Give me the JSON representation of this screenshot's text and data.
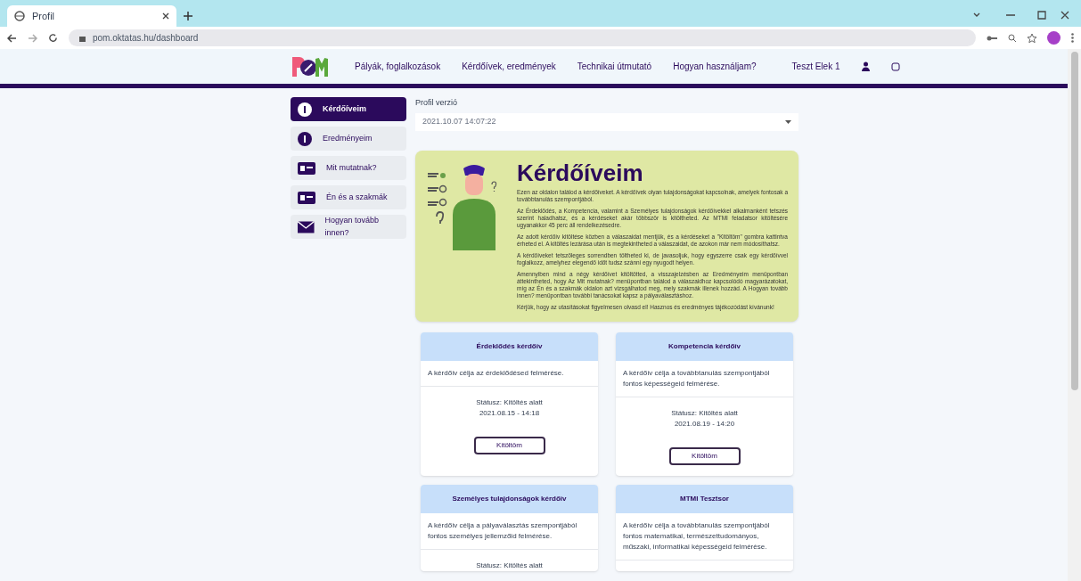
{
  "browser": {
    "tab_title": "Profil",
    "url": "pom.oktatas.hu/dashboard"
  },
  "header": {
    "nav": [
      {
        "label": "Pályák, foglalkozások"
      },
      {
        "label": "Kérdőívek, eredmények"
      },
      {
        "label": "Technikai útmutató"
      },
      {
        "label": "Hogyan használjam?"
      }
    ],
    "user": "Teszt Elek 1"
  },
  "sidebar": {
    "items": [
      {
        "label": "Kérdőíveim",
        "selected": true
      },
      {
        "label": "Eredményeim",
        "selected": false
      },
      {
        "label": "Mit mutatnak?",
        "selected": false
      },
      {
        "label": "Én és a szakmák",
        "selected": false
      },
      {
        "label": "Hogyan tovább innen?",
        "selected": false
      }
    ]
  },
  "profile": {
    "label": "Profil verzió",
    "value": "2021.10.07 14:07:22"
  },
  "hero": {
    "title": "Kérdőíveim",
    "paragraphs": [
      "Ezen az oldalon találod a kérdőíveket. A kérdőívek olyan tulajdonságokat kapcsolnak, amelyek fontosak a továbbtanulás szempontjából.",
      "Az Érdeklődés, a Kompetencia, valamint a Személyes tulajdonságok kérdőívekkel alkalmanként tetszés szerint haladhatsz, és a kérdéseket akár többször is kitöltheted. Az MTMI feladatsor kitöltésére ugyanakkor 45 perc áll rendelkezésedre.",
      "Az adott kérdőív kitöltése közben a válaszaidat mentjük, és a kérdéseket a \"Kitöltöm\" gombra kattintva érheted el. A kitöltés lezárása után is megtekintheted a válaszaidat, de azokon már nem módosíthatsz.",
      "A kérdőíveket tetszőleges sorrendben töltheted ki, de javasoljuk, hogy egyszerre csak egy kérdőívvel foglalkozz, amelyhez elegendő időt tudsz szánni egy nyugodt helyen.",
      "Amennyiben mind a négy kérdőívet kitöltötted, a visszajelzésben az Eredményeim menüpontban áttekintheted, hogy Az Mit mutatnak? menüpontban találod a válaszaidhoz kapcsolódó magyarázatokat, míg az Én és a szakmák oldalon azt vizsgálhatod meg, mely szakmák illenek hozzád. A Hogyan tovább innen? menüpontban további tanácsokat kapsz a pályaválasztáshoz.",
      "Kérjük, hogy az utasításokat figyelmesen olvasd el! Hasznos és eredményes tájékozódást kívánunk!"
    ]
  },
  "cards": [
    {
      "title": "Érdeklődés kérdőív",
      "description": "A kérdőív célja az érdeklődésed felmérése.",
      "status": "Státusz: Kitöltés alatt",
      "date": "2021.08.15 - 14:18",
      "button": "Kitöltöm"
    },
    {
      "title": "Kompetencia kérdőív",
      "description": "A kérdőív célja a továbbtanulás szempontjából fontos képességeid felmérése.",
      "status": "Státusz: Kitöltés alatt",
      "date": "2021.08.19 - 14:20",
      "button": "Kitöltöm"
    },
    {
      "title": "Személyes tulajdonságok kérdőív",
      "description": "A kérdőív célja a pályaválasztás szempontjából fontos személyes jellemzőid felmérése.",
      "status": "Státusz: Kitöltés alatt"
    },
    {
      "title": "MTMI Tesztsor",
      "description": "A kérdőív célja a továbbtanulás szempontjából fontos matematikai, természettudományos, műszaki, informatikai képességeid felmérése."
    }
  ]
}
